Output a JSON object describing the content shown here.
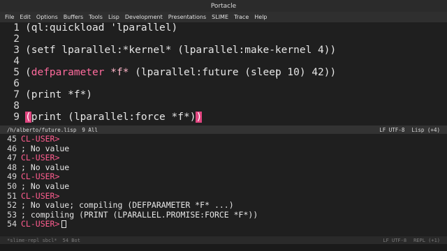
{
  "window": {
    "title": "Portacle"
  },
  "menu": [
    "File",
    "Edit",
    "Options",
    "Buffers",
    "Tools",
    "Lisp",
    "Development",
    "Presentations",
    "SLIME",
    "Trace",
    "Help"
  ],
  "editor": {
    "lines": [
      {
        "n": "1",
        "segments": [
          {
            "t": "(ql:quickload 'lparallel)",
            "c": ""
          }
        ]
      },
      {
        "n": "2",
        "segments": []
      },
      {
        "n": "3",
        "segments": [
          {
            "t": "(setf lparallel:*kernel* (lparallel:make-kernel 4))",
            "c": ""
          }
        ]
      },
      {
        "n": "4",
        "segments": []
      },
      {
        "n": "5",
        "segments": [
          {
            "t": "(",
            "c": ""
          },
          {
            "t": "defparameter",
            "c": "kw"
          },
          {
            "t": " ",
            "c": ""
          },
          {
            "t": "*f*",
            "c": "var"
          },
          {
            "t": " (lparallel:future (sleep 10) 42))",
            "c": ""
          }
        ]
      },
      {
        "n": "6",
        "segments": []
      },
      {
        "n": "7",
        "segments": [
          {
            "t": "(print *f*)",
            "c": ""
          }
        ]
      },
      {
        "n": "8",
        "segments": []
      },
      {
        "n": "9",
        "segments": [
          {
            "t": "(",
            "c": "paren-hl"
          },
          {
            "t": "print (lparallel:force *f*)",
            "c": ""
          },
          {
            "t": ")",
            "c": "paren-hl"
          }
        ]
      }
    ]
  },
  "modeline_top": {
    "file": "/h/alberto/future.lisp",
    "position": "9 All",
    "encoding": "LF UTF-8",
    "mode": "Lisp (+4)"
  },
  "repl": {
    "lines": [
      {
        "n": "45",
        "text": "CL-USER>",
        "kind": "prompt"
      },
      {
        "n": "46",
        "text": "; No value",
        "kind": "comment"
      },
      {
        "n": "47",
        "text": "CL-USER>",
        "kind": "prompt"
      },
      {
        "n": "48",
        "text": "; No value",
        "kind": "comment"
      },
      {
        "n": "49",
        "text": "CL-USER>",
        "kind": "prompt"
      },
      {
        "n": "50",
        "text": "; No value",
        "kind": "comment"
      },
      {
        "n": "51",
        "text": "CL-USER>",
        "kind": "prompt"
      },
      {
        "n": "52",
        "text": "; No value; compiling (DEFPARAMETER *F* ...)",
        "kind": "comment"
      },
      {
        "n": "53",
        "text": "; compiling (PRINT (LPARALLEL.PROMISE:FORCE *F*))",
        "kind": "comment"
      },
      {
        "n": "54",
        "text": "CL-USER>",
        "kind": "prompt-cursor"
      }
    ]
  },
  "modeline_bottom": {
    "buffer": "*slime-repl sbcl*",
    "position": "54 Bot",
    "encoding": "LF UTF-8",
    "mode": "REPL (+1)"
  }
}
